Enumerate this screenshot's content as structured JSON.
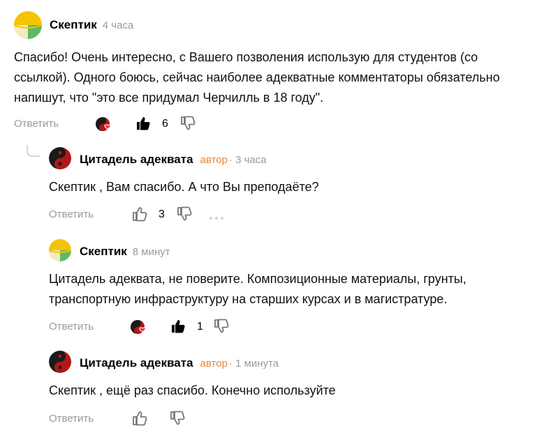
{
  "comments": [
    {
      "author": "Скептик",
      "time": "4 часа",
      "text": "Спасибо! Очень интересно, с Вашего позволения использую для студентов (со\nссылкой). Одного боюсь, сейчас наиболее адекватные комментаторы обязательно\nнапишут, что \"это все придумал Черчилль в 18 году\".",
      "reply_label": "Ответить",
      "likes": "6",
      "avatar_icon": "yellow-green-avatar",
      "like_state": "filled"
    },
    {
      "author": "Цитадель адеквата",
      "badge": "автор",
      "time": "· 3 часа",
      "text": "Скептик , Вам спасибо. А что Вы преподаёте?",
      "reply_label": "Ответить",
      "likes": "3",
      "avatar_icon": "yin-yang-avatar",
      "like_state": "outline"
    },
    {
      "author": "Скептик",
      "time": "8 минут",
      "text": "Цитадель адеквата, не поверите. Композиционные материалы, грунты,\nтранспортную инфраструктуру на старших курсах и в магистратуре.",
      "reply_label": "Ответить",
      "likes": "1",
      "avatar_icon": "yellow-green-avatar",
      "like_state": "filled"
    },
    {
      "author": "Цитадель адеквата",
      "badge": "автор",
      "time": "· 1 минута",
      "text": "Скептик , ещё раз спасибо. Конечно используйте",
      "reply_label": "Ответить",
      "avatar_icon": "yin-yang-avatar",
      "like_state": "outline"
    }
  ],
  "colors": {
    "author_badge": "#e6873a",
    "muted": "#9a9a9a",
    "avatar_yellow": "#f5c400",
    "avatar_green": "#5fb86a",
    "reaction_heart": "#e8344a"
  }
}
